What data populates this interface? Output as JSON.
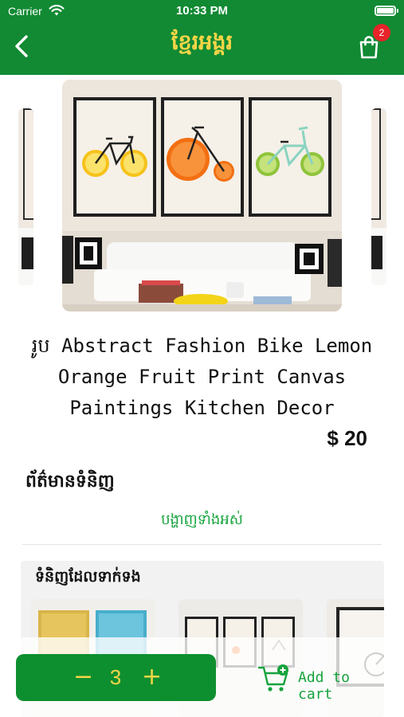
{
  "status_bar": {
    "carrier": "Carrier",
    "time": "10:33 PM"
  },
  "header": {
    "title": "ខ្មែរអង្គរ",
    "cart_count": "2"
  },
  "product": {
    "name": "រូប Abstract Fashion Bike Lemon Orange Fruit Print Canvas Paintings Kitchen Decor",
    "price": "$ 20"
  },
  "info": {
    "title": "ព័ត៌មានទំនិញ",
    "show_all": "បង្ហាញទាំងអស់"
  },
  "related": {
    "title": "ទំនិញដែលទាក់ទង"
  },
  "bottom": {
    "minus": "−",
    "quantity": "3",
    "plus": "+",
    "add_to_cart": "Add to cart"
  },
  "colors": {
    "brand_green": "#118a33",
    "accent_yellow": "#f7d547",
    "badge_red": "#e8232a",
    "link_green": "#16a33d"
  }
}
